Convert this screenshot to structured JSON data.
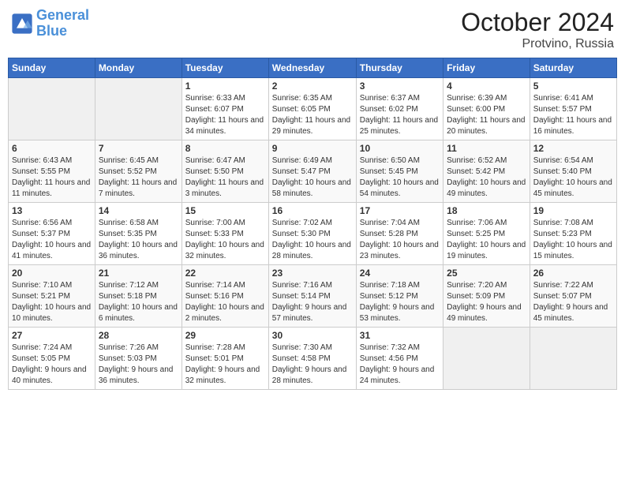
{
  "header": {
    "logo_line1": "General",
    "logo_line2": "Blue",
    "month": "October 2024",
    "location": "Protvino, Russia"
  },
  "weekdays": [
    "Sunday",
    "Monday",
    "Tuesday",
    "Wednesday",
    "Thursday",
    "Friday",
    "Saturday"
  ],
  "weeks": [
    [
      {
        "day": "",
        "empty": true
      },
      {
        "day": "",
        "empty": true
      },
      {
        "day": "1",
        "sunrise": "Sunrise: 6:33 AM",
        "sunset": "Sunset: 6:07 PM",
        "daylight": "Daylight: 11 hours and 34 minutes."
      },
      {
        "day": "2",
        "sunrise": "Sunrise: 6:35 AM",
        "sunset": "Sunset: 6:05 PM",
        "daylight": "Daylight: 11 hours and 29 minutes."
      },
      {
        "day": "3",
        "sunrise": "Sunrise: 6:37 AM",
        "sunset": "Sunset: 6:02 PM",
        "daylight": "Daylight: 11 hours and 25 minutes."
      },
      {
        "day": "4",
        "sunrise": "Sunrise: 6:39 AM",
        "sunset": "Sunset: 6:00 PM",
        "daylight": "Daylight: 11 hours and 20 minutes."
      },
      {
        "day": "5",
        "sunrise": "Sunrise: 6:41 AM",
        "sunset": "Sunset: 5:57 PM",
        "daylight": "Daylight: 11 hours and 16 minutes."
      }
    ],
    [
      {
        "day": "6",
        "sunrise": "Sunrise: 6:43 AM",
        "sunset": "Sunset: 5:55 PM",
        "daylight": "Daylight: 11 hours and 11 minutes."
      },
      {
        "day": "7",
        "sunrise": "Sunrise: 6:45 AM",
        "sunset": "Sunset: 5:52 PM",
        "daylight": "Daylight: 11 hours and 7 minutes."
      },
      {
        "day": "8",
        "sunrise": "Sunrise: 6:47 AM",
        "sunset": "Sunset: 5:50 PM",
        "daylight": "Daylight: 11 hours and 3 minutes."
      },
      {
        "day": "9",
        "sunrise": "Sunrise: 6:49 AM",
        "sunset": "Sunset: 5:47 PM",
        "daylight": "Daylight: 10 hours and 58 minutes."
      },
      {
        "day": "10",
        "sunrise": "Sunrise: 6:50 AM",
        "sunset": "Sunset: 5:45 PM",
        "daylight": "Daylight: 10 hours and 54 minutes."
      },
      {
        "day": "11",
        "sunrise": "Sunrise: 6:52 AM",
        "sunset": "Sunset: 5:42 PM",
        "daylight": "Daylight: 10 hours and 49 minutes."
      },
      {
        "day": "12",
        "sunrise": "Sunrise: 6:54 AM",
        "sunset": "Sunset: 5:40 PM",
        "daylight": "Daylight: 10 hours and 45 minutes."
      }
    ],
    [
      {
        "day": "13",
        "sunrise": "Sunrise: 6:56 AM",
        "sunset": "Sunset: 5:37 PM",
        "daylight": "Daylight: 10 hours and 41 minutes."
      },
      {
        "day": "14",
        "sunrise": "Sunrise: 6:58 AM",
        "sunset": "Sunset: 5:35 PM",
        "daylight": "Daylight: 10 hours and 36 minutes."
      },
      {
        "day": "15",
        "sunrise": "Sunrise: 7:00 AM",
        "sunset": "Sunset: 5:33 PM",
        "daylight": "Daylight: 10 hours and 32 minutes."
      },
      {
        "day": "16",
        "sunrise": "Sunrise: 7:02 AM",
        "sunset": "Sunset: 5:30 PM",
        "daylight": "Daylight: 10 hours and 28 minutes."
      },
      {
        "day": "17",
        "sunrise": "Sunrise: 7:04 AM",
        "sunset": "Sunset: 5:28 PM",
        "daylight": "Daylight: 10 hours and 23 minutes."
      },
      {
        "day": "18",
        "sunrise": "Sunrise: 7:06 AM",
        "sunset": "Sunset: 5:25 PM",
        "daylight": "Daylight: 10 hours and 19 minutes."
      },
      {
        "day": "19",
        "sunrise": "Sunrise: 7:08 AM",
        "sunset": "Sunset: 5:23 PM",
        "daylight": "Daylight: 10 hours and 15 minutes."
      }
    ],
    [
      {
        "day": "20",
        "sunrise": "Sunrise: 7:10 AM",
        "sunset": "Sunset: 5:21 PM",
        "daylight": "Daylight: 10 hours and 10 minutes."
      },
      {
        "day": "21",
        "sunrise": "Sunrise: 7:12 AM",
        "sunset": "Sunset: 5:18 PM",
        "daylight": "Daylight: 10 hours and 6 minutes."
      },
      {
        "day": "22",
        "sunrise": "Sunrise: 7:14 AM",
        "sunset": "Sunset: 5:16 PM",
        "daylight": "Daylight: 10 hours and 2 minutes."
      },
      {
        "day": "23",
        "sunrise": "Sunrise: 7:16 AM",
        "sunset": "Sunset: 5:14 PM",
        "daylight": "Daylight: 9 hours and 57 minutes."
      },
      {
        "day": "24",
        "sunrise": "Sunrise: 7:18 AM",
        "sunset": "Sunset: 5:12 PM",
        "daylight": "Daylight: 9 hours and 53 minutes."
      },
      {
        "day": "25",
        "sunrise": "Sunrise: 7:20 AM",
        "sunset": "Sunset: 5:09 PM",
        "daylight": "Daylight: 9 hours and 49 minutes."
      },
      {
        "day": "26",
        "sunrise": "Sunrise: 7:22 AM",
        "sunset": "Sunset: 5:07 PM",
        "daylight": "Daylight: 9 hours and 45 minutes."
      }
    ],
    [
      {
        "day": "27",
        "sunrise": "Sunrise: 7:24 AM",
        "sunset": "Sunset: 5:05 PM",
        "daylight": "Daylight: 9 hours and 40 minutes."
      },
      {
        "day": "28",
        "sunrise": "Sunrise: 7:26 AM",
        "sunset": "Sunset: 5:03 PM",
        "daylight": "Daylight: 9 hours and 36 minutes."
      },
      {
        "day": "29",
        "sunrise": "Sunrise: 7:28 AM",
        "sunset": "Sunset: 5:01 PM",
        "daylight": "Daylight: 9 hours and 32 minutes."
      },
      {
        "day": "30",
        "sunrise": "Sunrise: 7:30 AM",
        "sunset": "Sunset: 4:58 PM",
        "daylight": "Daylight: 9 hours and 28 minutes."
      },
      {
        "day": "31",
        "sunrise": "Sunrise: 7:32 AM",
        "sunset": "Sunset: 4:56 PM",
        "daylight": "Daylight: 9 hours and 24 minutes."
      },
      {
        "day": "",
        "empty": true
      },
      {
        "day": "",
        "empty": true
      }
    ]
  ]
}
